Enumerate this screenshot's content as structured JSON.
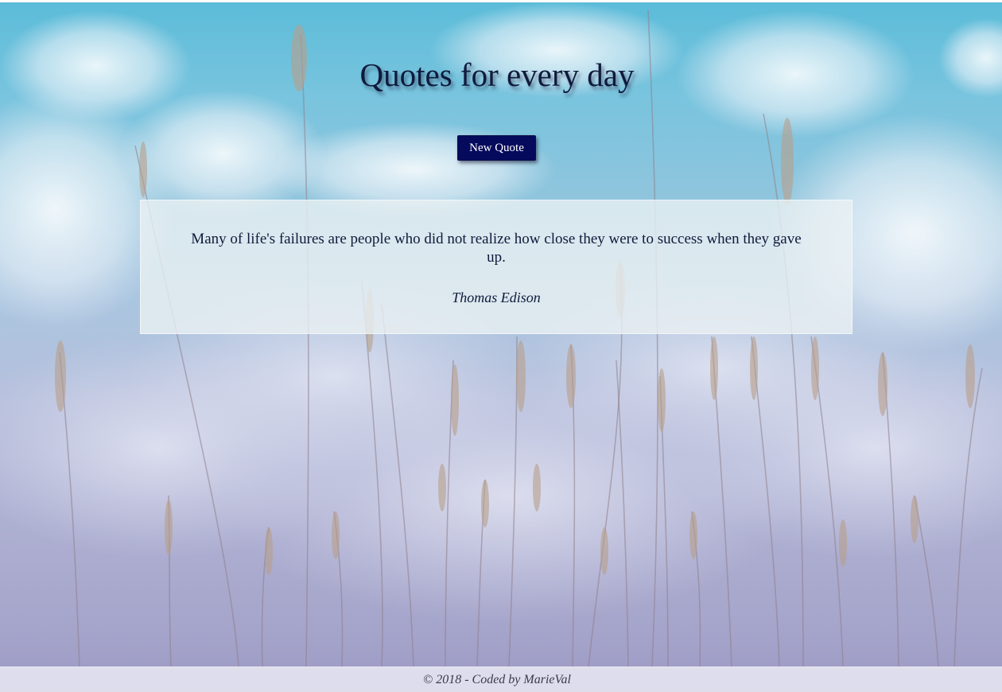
{
  "header": {
    "title": "Quotes for every day"
  },
  "controls": {
    "new_quote_label": "New Quote"
  },
  "quote": {
    "text": "Many of life's failures are people who did not realize how close they were to success when they gave up.",
    "author": "Thomas Edison"
  },
  "footer": {
    "text": "© 2018 - Coded by MarieVal"
  },
  "theme": {
    "button_color": "#060a5c",
    "text_color": "#0f1a3c",
    "sky_top": "#5bbcd9",
    "sky_bottom": "#9c9ac4"
  },
  "background": {
    "image_icon": "sky-and-grass-photo"
  }
}
